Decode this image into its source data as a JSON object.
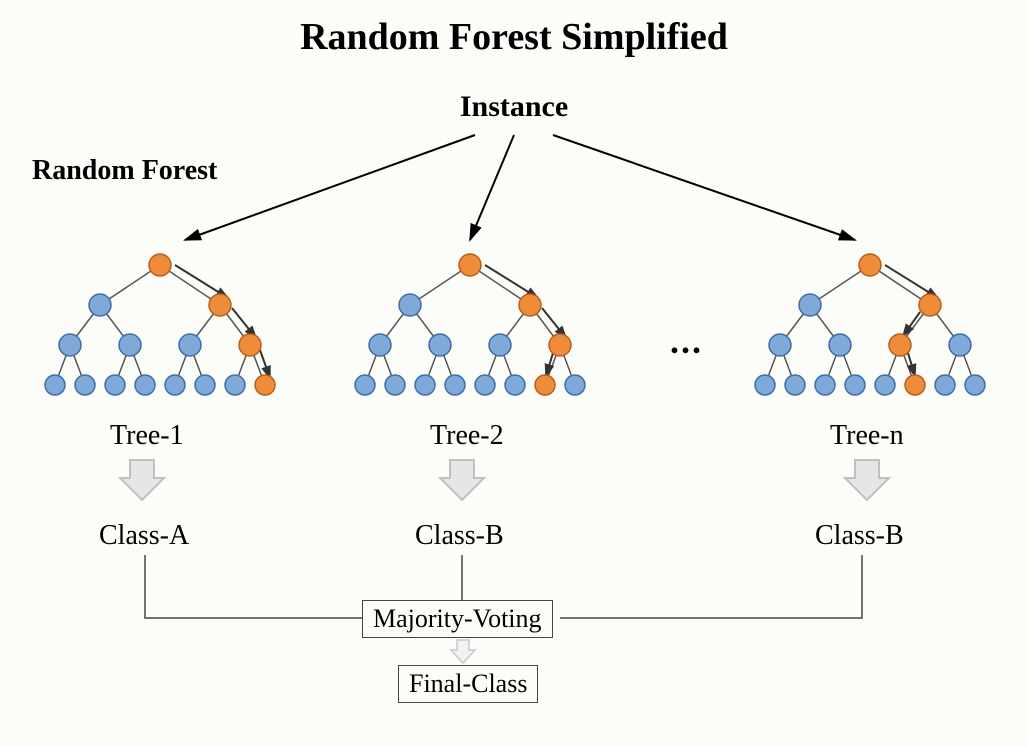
{
  "title": "Random Forest Simplified",
  "instance_label": "Instance",
  "forest_label": "Random Forest",
  "ellipsis": "...",
  "trees": [
    {
      "label": "Tree-1",
      "class": "Class-A",
      "path_variant": "right-right-right"
    },
    {
      "label": "Tree-2",
      "class": "Class-B",
      "path_variant": "right-right-left"
    },
    {
      "label": "Tree-n",
      "class": "Class-B",
      "path_variant": "right-left-right"
    }
  ],
  "voting_label": "Majority-Voting",
  "final_label": "Final-Class",
  "colors": {
    "node_blue": "#7fa9d9",
    "node_blue_stroke": "#3d6fa5",
    "node_orange": "#ef8c3a",
    "node_orange_stroke": "#b85f1a",
    "edge": "#555",
    "big_arrow": "#000",
    "down_arrow_fill": "#dcdcdc",
    "down_arrow_stroke": "#b8b8b8",
    "line": "#444"
  }
}
